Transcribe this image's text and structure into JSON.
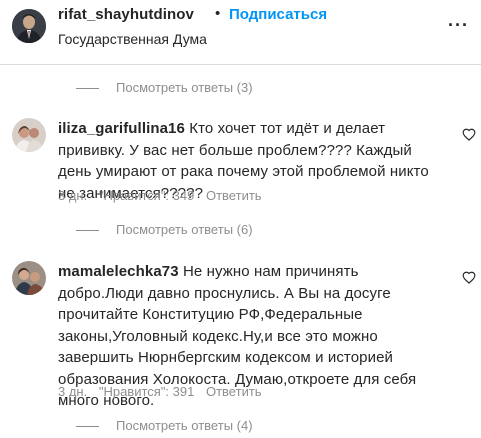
{
  "header": {
    "username": "rifat_shayhutdinov",
    "separator": "•",
    "follow_label": "Подписаться",
    "subtitle": "Государственная Дума",
    "more_icon": "more-horizontal-icon"
  },
  "threads": [
    {
      "label": "Посмотреть ответы (3)"
    },
    {
      "label": "Посмотреть ответы (6)"
    },
    {
      "label": "Посмотреть ответы (4)"
    }
  ],
  "comments": [
    {
      "username": "iliza_garifullina16",
      "text": "Кто хочет тот идёт и делает прививку. У вас нет больше проблем???? Каждый день умирают от рака почему этой проблемой никто не занимается?????",
      "time": "3 дн.",
      "likes": "\"Нравится\": 349",
      "reply_label": "Ответить"
    },
    {
      "username": "mamalelechka73",
      "text": "Не нужно нам причинять добро.Люди давно проснулись. А Вы на досуге прочитайте Конституцию РФ,Федеральные законы,Уголовный кодекс.Ну,и все это можно завершить Нюрнбергским кодексом и историей образования Холокоста. Думаю,откроете для себя много нового.",
      "time": "3 дн.",
      "likes": "\"Нравится\": 391",
      "reply_label": "Ответить"
    }
  ],
  "colors": {
    "link": "#0095f6",
    "muted": "#8e8e8e",
    "text": "#262626",
    "divider": "#dbdbdb"
  }
}
